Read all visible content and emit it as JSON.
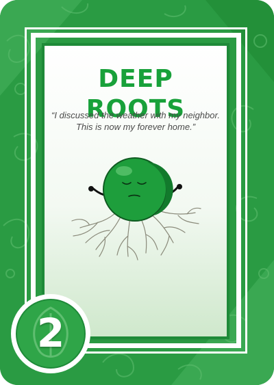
{
  "card": {
    "title": "DEEP ROOTS",
    "quote_line1": "“I discussed the weather with my neighbor.",
    "quote_line2": "This is now my forever home.”",
    "cost": "2",
    "colors": {
      "background": "#2a9b43",
      "title": "#18a13a",
      "pea": "#1e9e3c",
      "frame": "#ffffff"
    },
    "illustration": "pea-with-roots",
    "badge_icon": "leaf-icon"
  }
}
